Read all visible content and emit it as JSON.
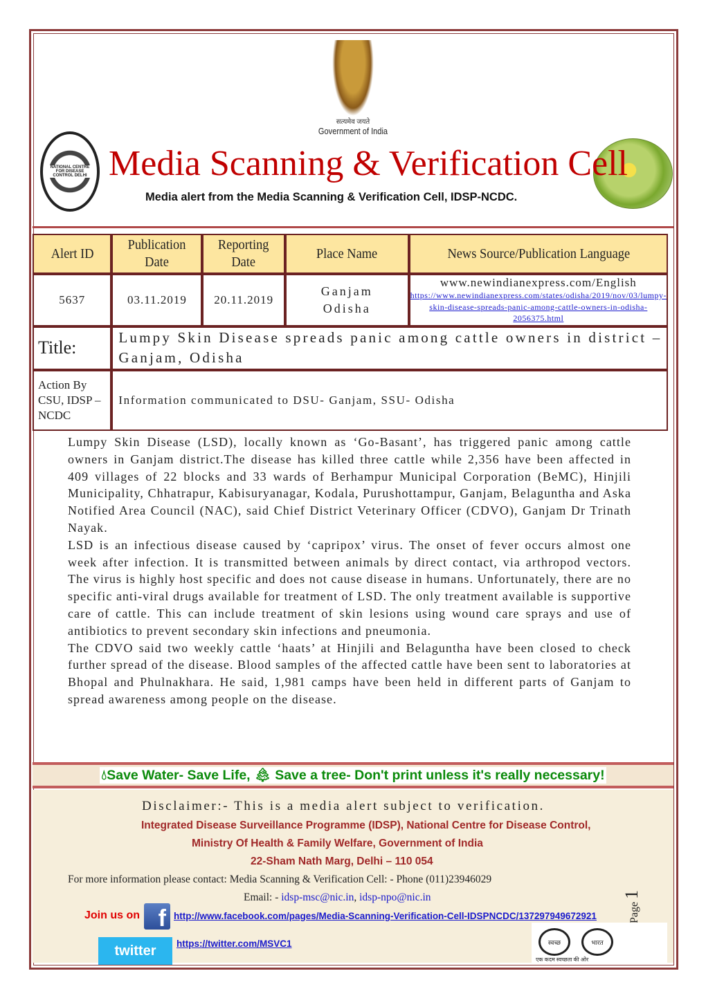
{
  "header": {
    "emblem_motto": "सत्यमेव जयते",
    "emblem_caption": "Government of India",
    "left_seal_text": "NATIONAL CENTRE FOR DISEASE CONTROL DELHI",
    "title": "Media Scanning & Verification Cell",
    "subtitle": "Media alert from the Media Scanning & Verification Cell, IDSP-NCDC."
  },
  "table": {
    "headers": [
      "Alert  ID",
      "Publication Date",
      "Reporting Date",
      "Place Name",
      "News Source/Publication Language"
    ],
    "alert_id": "5637",
    "publication_date": "03.11.2019",
    "reporting_date": "20.11.2019",
    "place_line1": "Ganjam",
    "place_line2": "Odisha",
    "source": "www.newindianexpress.com/English",
    "source_url": "https://www.newindianexpress.com/states/odisha/2019/nov/03/lumpy-skin-disease-spreads-panic-among-cattle-owners-in-odisha-2056375.html",
    "title_label": "Title:",
    "title": "Lumpy Skin Disease spreads panic among cattle owners in district –Ganjam, Odisha",
    "action_label": "Action By CSU, IDSP –NCDC",
    "action": "Information communicated to DSU- Ganjam, SSU- Odisha"
  },
  "body": {
    "paragraphs": [
      "Lumpy Skin Disease (LSD), locally known as ‘Go-Basant’, has triggered panic among cattle owners in Ganjam district.The disease has killed three cattle while 2,356 have been affected in 409 villages of 22 blocks and 33 wards of Berhampur Municipal Corporation (BeMC), Hinjili Municipality, Chhatrapur, Kabisuryanagar, Kodala, Purushottampur, Ganjam, Belaguntha and Aska  Notified Area Council (NAC), said Chief District Veterinary Officer (CDVO), Ganjam Dr Trinath Nayak.",
      "LSD is an infectious disease caused by ‘capripox’ virus. The onset of fever occurs almost one week after infection. It is transmitted between animals by direct contact, via arthropod vectors. The virus is highly host specific and does not cause disease in humans. Unfortunately, there are no specific anti-viral drugs available for treatment of LSD. The only treatment available is supportive care of cattle. This can include treatment of skin lesions using wound care sprays and use of antibiotics to prevent secondary skin infections and pneumonia.",
      "The CDVO said two weekly cattle ‘haats’ at Hinjili and Belaguntha have been closed to check further spread of the disease. Blood samples of the affected cattle have been sent to laboratories at Bhopal and Phulnakhara. He said, 1,981 camps have been held in different parts of Ganjam to spread awareness among people on the disease."
    ]
  },
  "footer": {
    "save_water": "Save Water- Save Life,",
    "save_tree": "Save a tree- Don't print unless it's really necessary!",
    "disclaimer": "Disclaimer:- This is a media alert subject to verification.",
    "org1": "Integrated Disease Surveillance Programme (IDSP), National Centre for Disease Control,",
    "org2": "Ministry Of Health & Family Welfare, Government of India",
    "org3": "22-Sham Nath Marg, Delhi – 110 054",
    "contact": "For more information please contact: Media Scanning & Verification Cell: - Phone (011)23946029",
    "email_label": "Email: -",
    "email1": "idsp-msc@nic.in",
    "email2": "idsp-npo@nic.in",
    "join": "Join us on",
    "facebook_url": "http://www.facebook.com/pages/Media-Scanning-Verification-Cell-IDSPNCDC/137297949672921",
    "twitter_label": "twitter",
    "twitter_url": "https://twitter.com/MSVC1",
    "page_label": "Page",
    "page_number": "1",
    "swachh_left": "स्वच्छ",
    "swachh_right": "भारत",
    "swachh_tagline": "एक कदम स्वच्छता की ओर"
  },
  "colors": {
    "title_red": "#c00000",
    "header_fill": "#fde6a0",
    "border": "#6b2222",
    "green": "#0a8a0a",
    "footer_bg": "#f6eedb"
  }
}
